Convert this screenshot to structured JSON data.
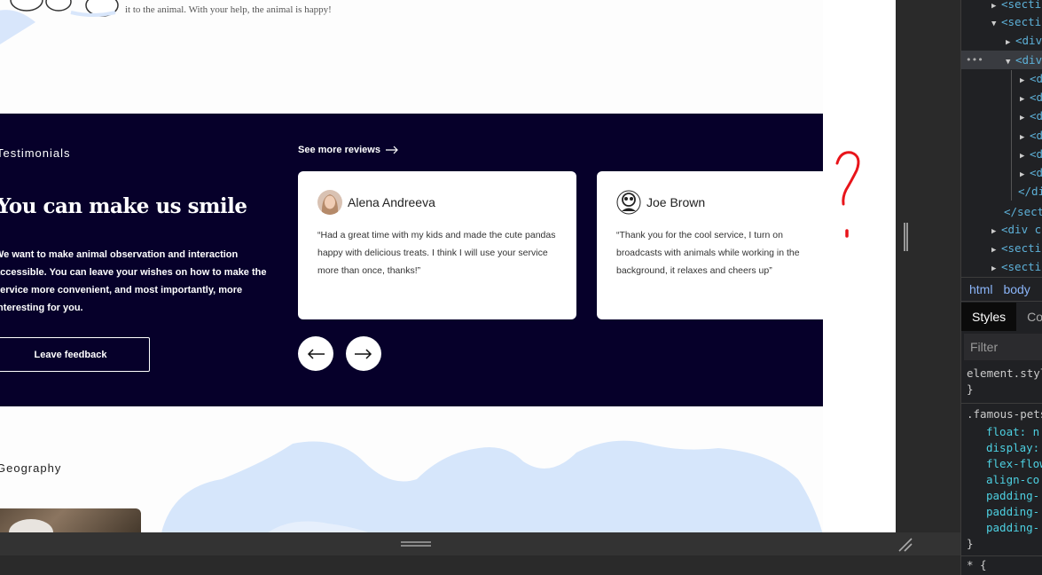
{
  "page": {
    "top_text": "it to the animal. With your help, the animal is happy!",
    "testimonials": {
      "label": "Testimonials",
      "title": "You can make us smile",
      "description": "We want to make animal observation and interaction accessible. You can leave your wishes on how to make the service more convenient, and most importantly, more interesting for you.",
      "feedback_button": "Leave feedback",
      "see_more": "See more reviews",
      "cards": [
        {
          "name": "Alena Andreeva",
          "quote": "“Had a great time with my kids and made the cute pandas happy with delicious treats. I think I will use your service more than once, thanks!”"
        },
        {
          "name": "Joe Brown",
          "quote": "“Thank you for the cool service, I turn on broadcasts with animals while working in the background, it relaxes and cheers up”"
        }
      ]
    },
    "geography_label": "Geography",
    "annotation_color": "#e8141a"
  },
  "devtools": {
    "dom": [
      {
        "text": "<section"
      },
      {
        "text": "<section"
      },
      {
        "text": "<div"
      },
      {
        "text": "<div"
      },
      {
        "text": "<div"
      },
      {
        "text": "<div"
      },
      {
        "text": "<div"
      },
      {
        "text": "<div"
      },
      {
        "text": "<div"
      },
      {
        "text": "<div"
      },
      {
        "text": "</div>"
      },
      {
        "text": "</section>"
      },
      {
        "text": "<div c"
      },
      {
        "text": "<section"
      },
      {
        "text": "<section"
      }
    ],
    "dots": "•••",
    "breadcrumbs": [
      "html",
      "body"
    ],
    "tabs": [
      "Styles",
      "Computed"
    ],
    "filter_placeholder": "Filter",
    "styles": {
      "element_rule": "element.style",
      "open_brace": "{",
      "close_brace": "}",
      "famous_rule": ".famous-pets",
      "props": [
        "float: n",
        "display:",
        "flex-flow",
        "align-co",
        "padding-",
        "padding-",
        "padding-"
      ],
      "star_rule": "* {"
    }
  }
}
